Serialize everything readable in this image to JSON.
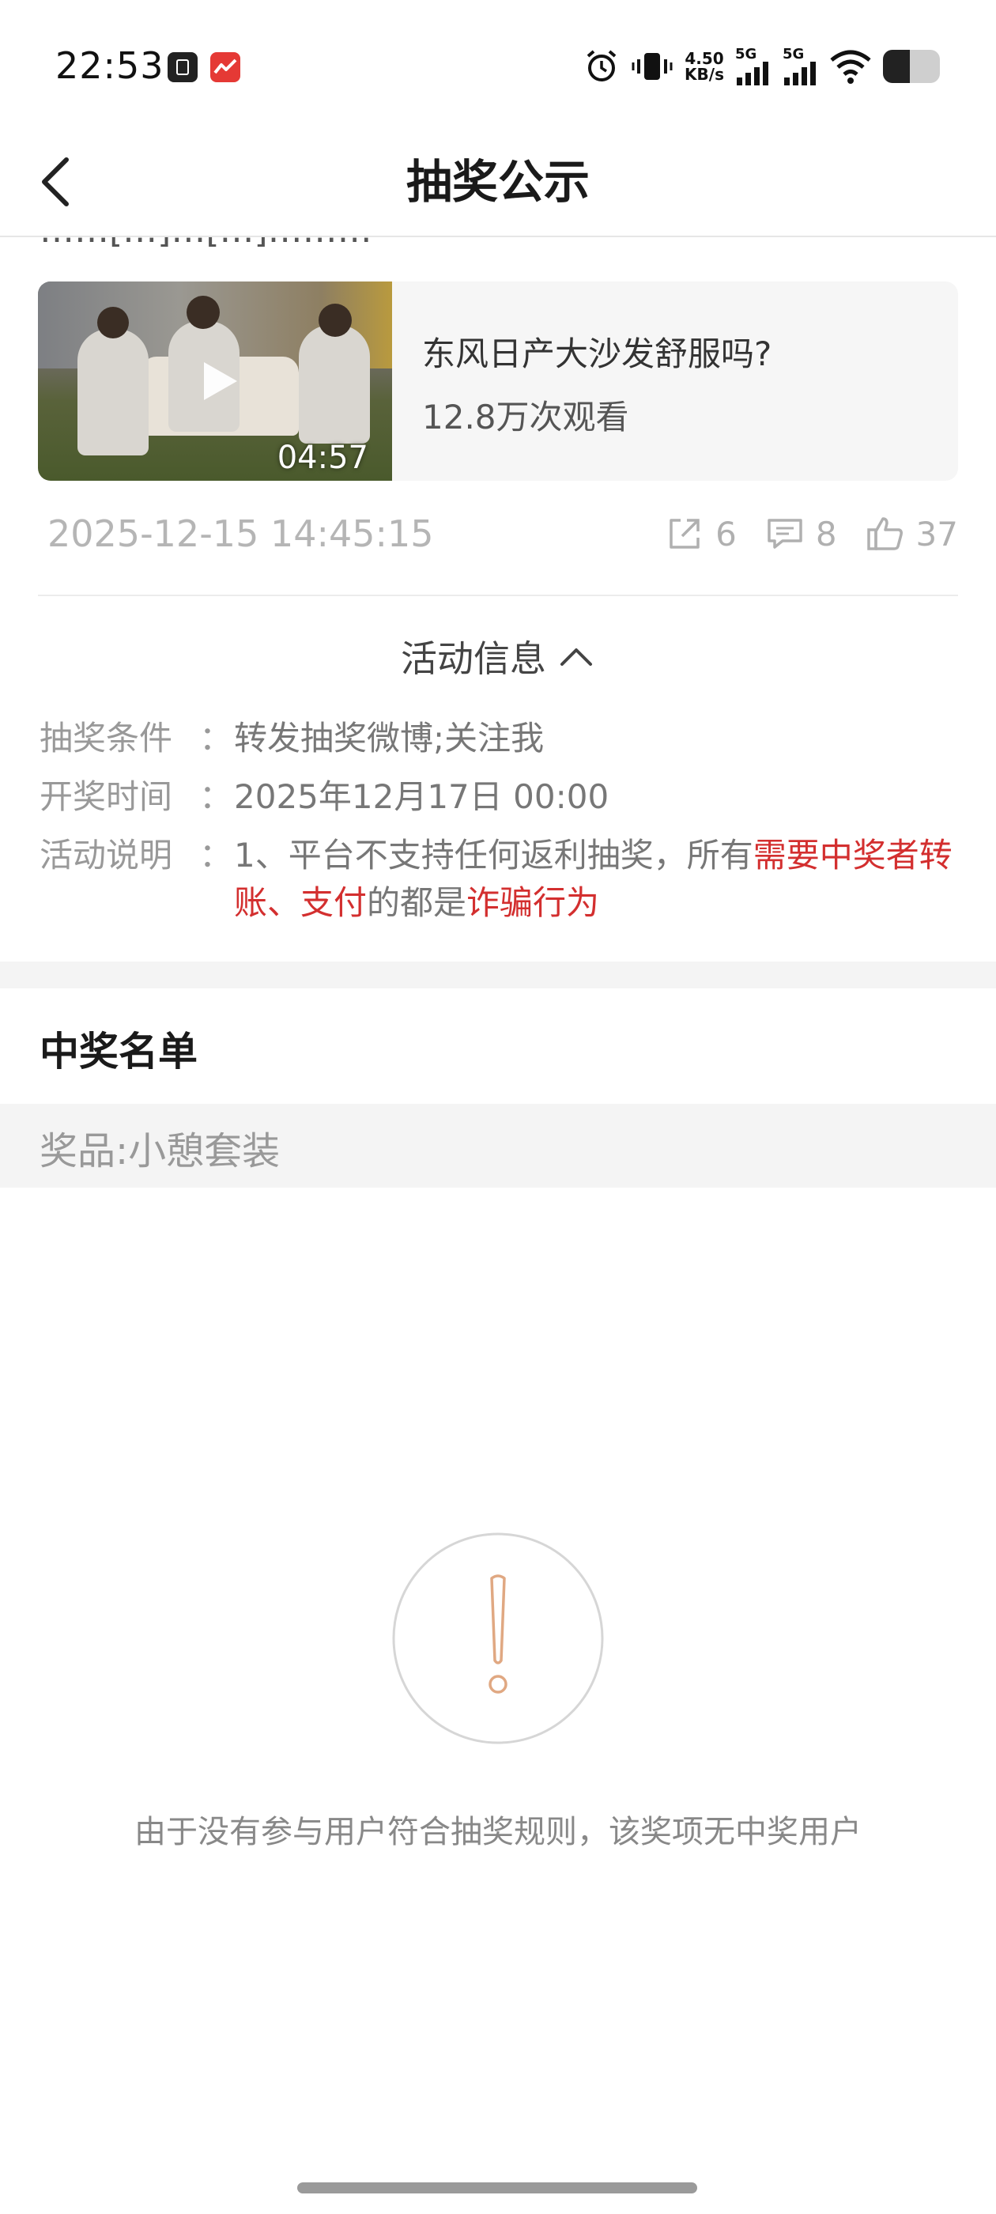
{
  "status_bar": {
    "time": "22:53",
    "net_speed_value": "4.50",
    "net_speed_unit": "KB/s",
    "signal_1_label": "5G",
    "signal_2_label": "5G",
    "icons": [
      "alarm-icon",
      "vibrate-icon",
      "signal-icon",
      "signal-icon",
      "wifi-icon",
      "battery-icon"
    ]
  },
  "header": {
    "title": "抽奖公示",
    "back_icon": "chevron-left-icon"
  },
  "post": {
    "clipped_line": "……[…]…[…]………",
    "video": {
      "title": "东风日产大沙发舒服吗?",
      "views": "12.8万次观看",
      "duration": "04:57"
    },
    "timestamp": "2025-12-15 14:45:15",
    "shares": "6",
    "comments": "8",
    "likes": "37"
  },
  "activity": {
    "toggle_label": "活动信息",
    "rows": [
      {
        "label": "抽奖条件",
        "colon": "：",
        "value": "转发抽奖微博;关注我"
      },
      {
        "label": "开奖时间",
        "colon": "：",
        "value": "2025年12月17日 00:00"
      },
      {
        "label": "活动说明",
        "colon": "：",
        "value_part1": "1、平台不支持任何返利抽奖，所有",
        "value_part2": "需要中奖者转账、支付",
        "value_part3": "的都是",
        "value_part4": "诈骗行为"
      }
    ],
    "warning_color": "#d32f2f"
  },
  "winners": {
    "heading": "中奖名单",
    "prize_label": "奖品:小憩套装",
    "empty_message": "由于没有参与用户符合抽奖规则，该奖项无中奖用户",
    "empty_icon": "exclamation-circle-icon",
    "empty_icon_color": "#e0a882"
  }
}
